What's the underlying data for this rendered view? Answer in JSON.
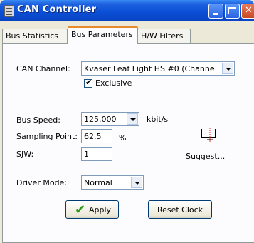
{
  "window": {
    "title": "CAN Controller"
  },
  "tabs": [
    "Bus Statistics",
    "Bus Parameters",
    "H/W Filters"
  ],
  "form": {
    "can_channel_label": "CAN Channel:",
    "can_channel_value": "Kvaser Leaf Light HS #0 (Channe",
    "exclusive_label": "Exclusive",
    "exclusive_checked": true,
    "bus_speed_label": "Bus Speed:",
    "bus_speed_value": "125.000",
    "bus_speed_unit": "kbit/s",
    "sampling_point_label": "Sampling Point:",
    "sampling_point_value": "62.5",
    "sampling_point_unit": "%",
    "sjw_label": "SJW:",
    "sjw_value": "1",
    "suggest_label": "Suggest...",
    "driver_mode_label": "Driver Mode:",
    "driver_mode_value": "Normal"
  },
  "buttons": {
    "apply": "Apply",
    "reset_clock": "Reset Clock"
  }
}
